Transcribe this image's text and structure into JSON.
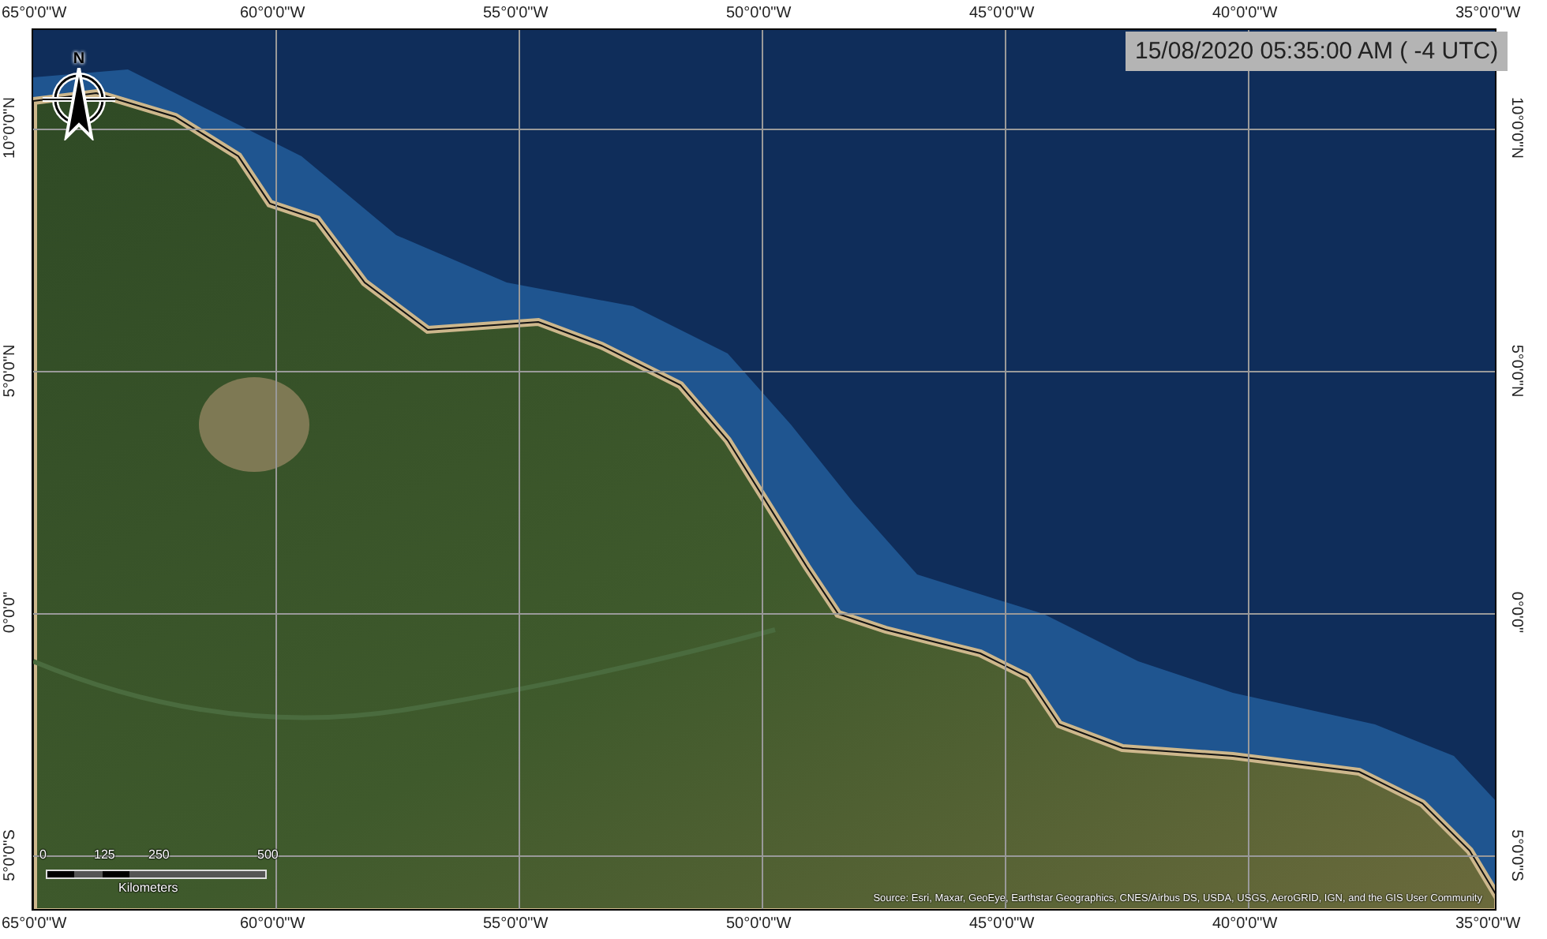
{
  "timestamp": "15/08/2020 05:35:00 AM ( -4 UTC)",
  "top_labels": [
    "65°0'0\"W",
    "60°0'0\"W",
    "55°0'0\"W",
    "50°0'0\"W",
    "45°0'0\"W",
    "40°0'0\"W",
    "35°0'0\"W"
  ],
  "bottom_labels": [
    "65°0'0\"W",
    "60°0'0\"W",
    "55°0'0\"W",
    "50°0'0\"W",
    "45°0'0\"W",
    "40°0'0\"W",
    "35°0'0\"W"
  ],
  "left_labels": [
    "10°0'0\"N",
    "5°0'0\"N",
    "0°0'0\"",
    "5°0'0\"S"
  ],
  "right_labels": [
    "10°0'0\"N",
    "5°0'0\"N",
    "0°0'0\"",
    "5°0'0\"S"
  ],
  "north_arrow": {
    "label": "N"
  },
  "scale_bar": {
    "ticks": [
      "0",
      "125",
      "250",
      "500"
    ],
    "unit": "Kilometers"
  },
  "attribution": "Source: Esri, Maxar, GeoEye, Earthstar Geographics, CNES/Airbus DS, USDA, USGS, AeroGRID, IGN, and the GIS User Community"
}
